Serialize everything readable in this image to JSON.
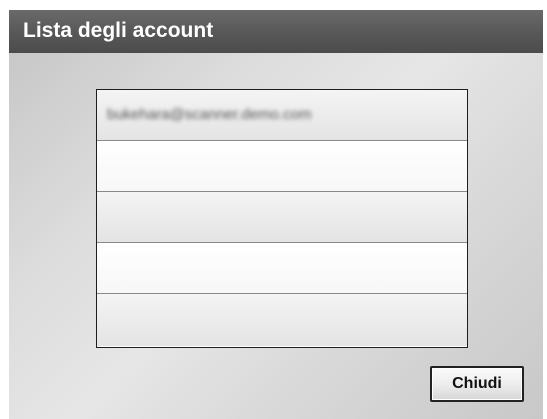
{
  "dialog": {
    "title": "Lista degli account",
    "accounts": [
      {
        "email": "bukehara@scanner.demo.com",
        "obscured": true
      },
      {
        "email": ""
      },
      {
        "email": ""
      },
      {
        "email": ""
      },
      {
        "email": ""
      }
    ],
    "close_label": "Chiudi"
  },
  "colors": {
    "title_bar": "#575757",
    "title_text": "#ffffff",
    "background": "#dcdcdc",
    "list_border": "#1e1e1e",
    "button_border": "#222222"
  }
}
